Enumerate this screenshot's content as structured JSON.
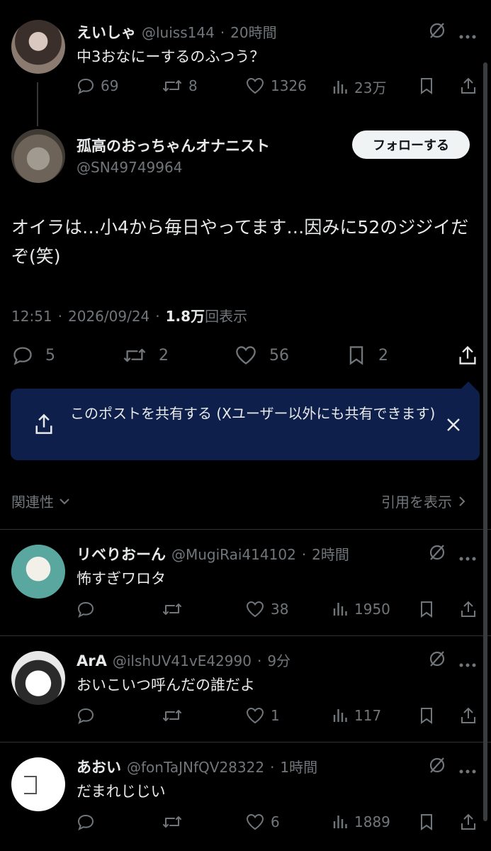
{
  "parent": {
    "name": "えいしゃ",
    "handle": "@luiss144",
    "sep": "·",
    "time": "20時間",
    "text": "中3おなにーするのふつう？",
    "replies": "69",
    "retweets": "8",
    "likes": "1326",
    "views": "23万"
  },
  "main": {
    "name": "孤高のおっちゃんオナニスト",
    "handle": "@SN49749964",
    "follow_label": "フォローする",
    "text": "オイラは…小4から毎日やってます…因みに52のジジイだぞ(笑)",
    "time": "12:51",
    "date": "2026/09/24",
    "sep": "·",
    "views_count": "1.8万",
    "views_label": "回表示",
    "replies": "5",
    "retweets": "2",
    "likes": "56",
    "bookmarks": "2"
  },
  "share_tip": {
    "text": "このポストを共有する (Xユーザー以外にも共有できます)"
  },
  "sort": {
    "label": "関連性",
    "quotes_label": "引用を表示"
  },
  "replies": [
    {
      "name": "リベりおーん",
      "handle": "@MugiRai414102",
      "sep": "·",
      "time": "2時間",
      "text": "怖すぎワロタ",
      "replies": "",
      "retweets": "",
      "likes": "38",
      "views": "1950"
    },
    {
      "name": "ArA",
      "handle": "@ilshUV41vE42990",
      "sep": "·",
      "time": "9分",
      "text": "おいこいつ呼んだの誰だよ",
      "replies": "",
      "retweets": "",
      "likes": "1",
      "views": "117"
    },
    {
      "name": "あおい",
      "handle": "@fonTaJNfQV28322",
      "sep": "·",
      "time": "1時間",
      "text": "だまれじじい",
      "replies": "",
      "retweets": "",
      "likes": "6",
      "views": "1889"
    }
  ],
  "colors": {
    "background": "#000000",
    "text": "#e7e9ea",
    "muted": "#71767b",
    "share_bg": "#0d1f4a"
  },
  "icons": [
    "reply-icon",
    "retweet-icon",
    "like-icon",
    "views-icon",
    "bookmark-icon",
    "share-icon",
    "grok-icon",
    "more-icon",
    "close-icon",
    "chevron-down-icon",
    "chevron-right-icon"
  ]
}
